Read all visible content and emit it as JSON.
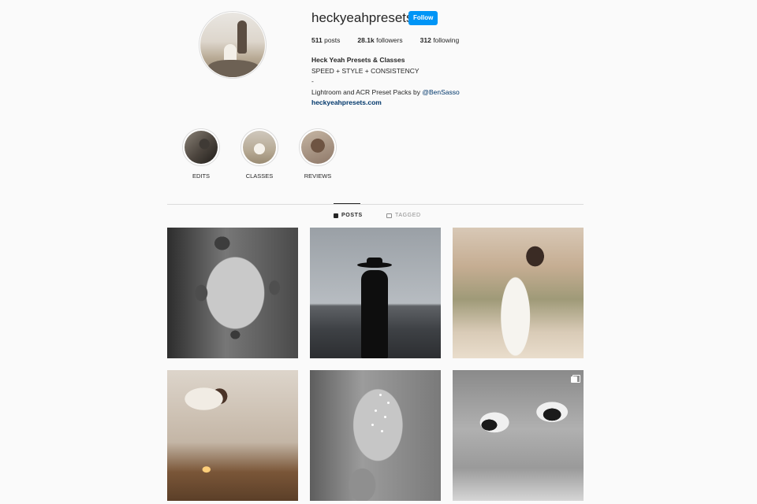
{
  "profile": {
    "username": "heckyeahpresets",
    "follow_label": "Follow",
    "stats": {
      "posts_count": "511",
      "posts_label": "posts",
      "followers_count": "28.1k",
      "followers_label": "followers",
      "following_count": "312",
      "following_label": "following"
    },
    "bio": {
      "name": "Heck Yeah Presets & Classes",
      "line1": "SPEED + STYLE + CONSISTENCY",
      "line2": "-",
      "line3_text": "Lightroom and ACR Preset Packs by ",
      "line3_mention": "@BenSasso",
      "website": "heckyeahpresets.com"
    }
  },
  "highlights": [
    {
      "label": "EDITS"
    },
    {
      "label": "CLASSES"
    },
    {
      "label": "REVIEWS"
    }
  ],
  "tabs": {
    "posts_label": "POSTS",
    "tagged_label": "TAGGED"
  },
  "posts": [
    {
      "icon": "photo"
    },
    {
      "icon": "photo"
    },
    {
      "icon": "photo"
    },
    {
      "icon": "photo"
    },
    {
      "icon": "photo"
    },
    {
      "icon": "multi-image-icon"
    }
  ],
  "colors": {
    "follow_button": "#0095f6",
    "link": "#00376b",
    "background": "#fafafa"
  }
}
